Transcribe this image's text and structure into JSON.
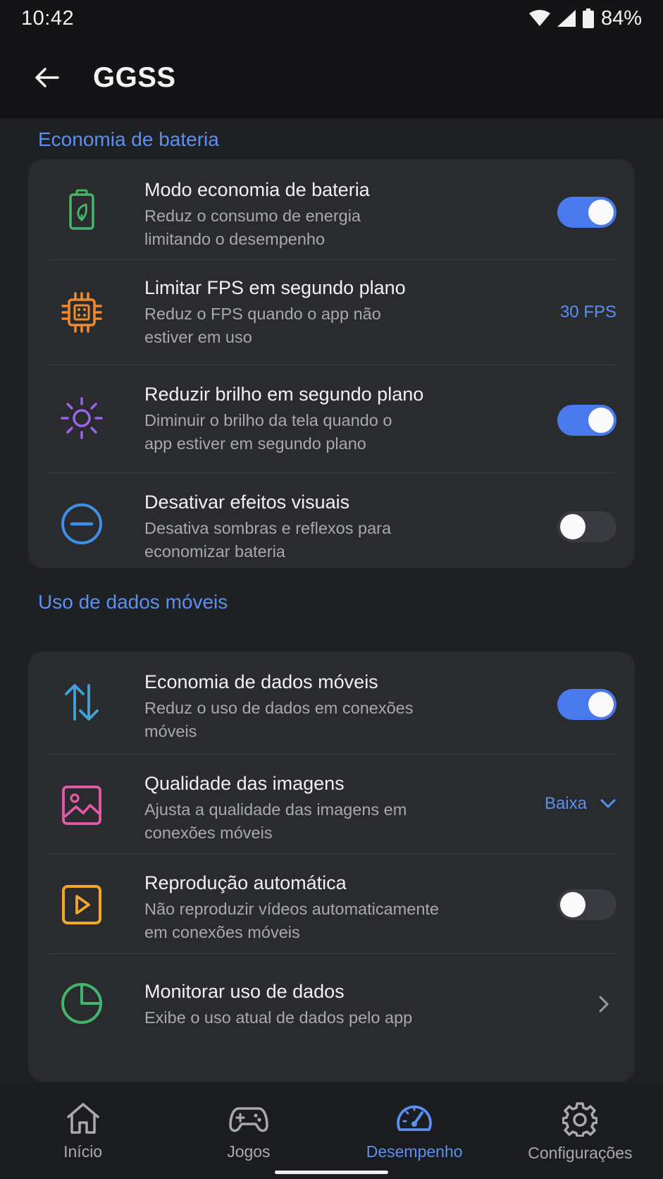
{
  "status_bar": {
    "time": "10:42",
    "battery_percent": "84%",
    "icons": [
      "wifi-icon",
      "signal-icon",
      "battery-icon"
    ]
  },
  "app_bar": {
    "title": "GGSS",
    "back_icon": "arrow-left-icon"
  },
  "sections": {
    "battery": {
      "title": "Economia de bateria",
      "items": [
        {
          "title": "Modo economia de bateria",
          "subtitle": [
            "Reduz o consumo de energia",
            "limitando o desempenho"
          ],
          "icon": "battery-leaf-icon",
          "toggle": true
        },
        {
          "title": "Limitar FPS em segundo plano",
          "subtitle": [
            "Reduz o FPS quando o app não",
            "estiver em uso"
          ],
          "icon": "cpu-chip-icon",
          "value": "30 FPS"
        },
        {
          "title": "Reduzir brilho em segundo plano",
          "subtitle": [
            "Diminuir o brilho da tela quando o",
            "app estiver em segundo plano"
          ],
          "icon": "sun-icon",
          "toggle": true
        },
        {
          "title": "Desativar efeitos visuais",
          "subtitle": [
            "Desativa sombras e reflexos para",
            "economizar bateria"
          ],
          "icon": "minus-circle-icon",
          "toggle": false
        }
      ]
    },
    "data": {
      "title": "Uso de dados móveis",
      "items": [
        {
          "title": "Economia de dados móveis",
          "subtitle": [
            "Reduz o uso de dados em conexões",
            "móveis"
          ],
          "icon": "data-arrows-icon",
          "toggle": true
        },
        {
          "title": "Qualidade das imagens",
          "subtitle": [
            "Ajusta a qualidade das imagens em",
            "conexões móveis"
          ],
          "icon": "image-icon",
          "dropdown": "Baixa"
        },
        {
          "title": "Reprodução automática",
          "subtitle": [
            "Não reproduzir vídeos automaticamente",
            "em conexões móveis"
          ],
          "icon": "play-box-icon",
          "toggle": false
        },
        {
          "title": "Monitorar uso de dados",
          "subtitle": [
            "Exibe o uso atual de dados pelo app"
          ],
          "icon": "pie-chart-icon"
        }
      ]
    }
  },
  "bottom_nav": {
    "items": [
      {
        "label": "Início",
        "icon": "home-icon",
        "active": false
      },
      {
        "label": "Jogos",
        "icon": "gamepad-icon",
        "active": false
      },
      {
        "label": "Desempenho",
        "icon": "speedometer-icon",
        "active": true
      },
      {
        "label": "Configurações",
        "icon": "gear-icon",
        "active": false
      }
    ]
  },
  "colors": {
    "accent": "#5b8ff0",
    "toggle_on": "#4a79ee",
    "card": "#2a2b2f",
    "background": "#1f2023",
    "bar": "#141416"
  }
}
